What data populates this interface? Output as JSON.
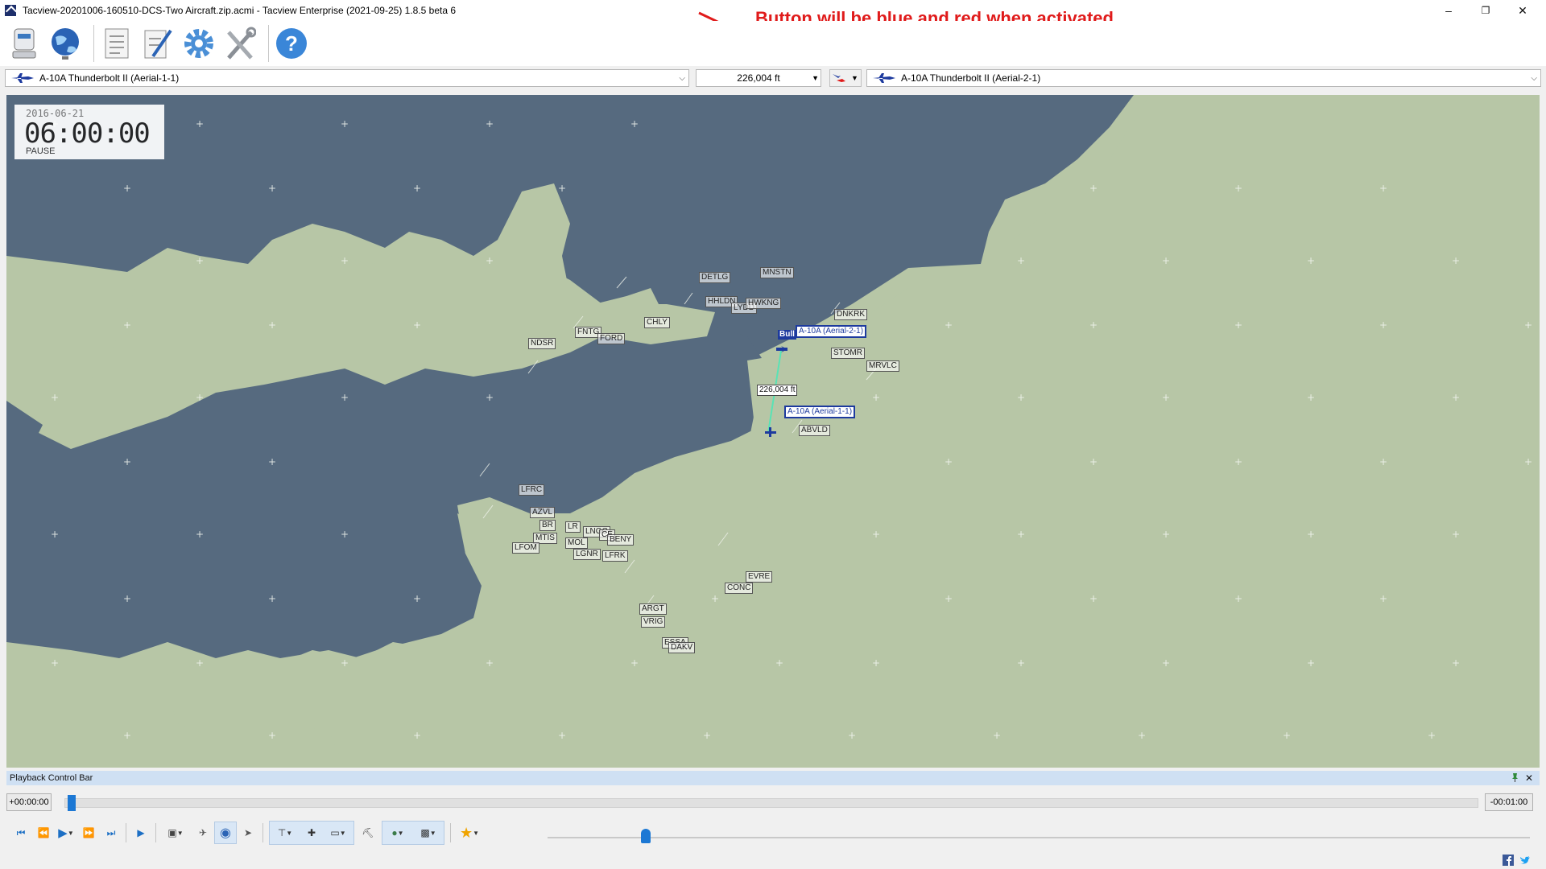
{
  "window": {
    "title": "Tacview-20201006-160510-DCS-Two Aircraft.zip.acmi - Tacview Enterprise (2021-09-25) 1.8.5 beta 6",
    "minimize": "–",
    "maximize": "❐",
    "close": "✕"
  },
  "annotation": {
    "text": "Button will be blue and red when activated",
    "color": "#e01b1b"
  },
  "toolbar": {
    "icons": [
      "recorder-icon",
      "globe-network-icon",
      "document-icon",
      "edit-notes-icon",
      "gear-icon",
      "tools-icon",
      "help-icon"
    ]
  },
  "selection": {
    "primary_object": "A-10A Thunderbolt II (Aerial-1-1)",
    "distance": "226,004 ft",
    "secondary_object": "A-10A Thunderbolt II (Aerial-2-1)",
    "link_button_colors": [
      "#1d3a9e",
      "#e01b1b"
    ]
  },
  "clock": {
    "date": "2016-06-21",
    "time": "06:00:00",
    "state": "PAUSE"
  },
  "map": {
    "sea_color": "#566a7f",
    "land_color": "#b7c6a6",
    "airfields": [
      "DETLG",
      "MNSTN",
      "HHLDN",
      "LYDD",
      "HWKNG",
      "CHLY",
      "FNTG",
      "FORD",
      "NDSR",
      "DNKRK",
      "STOMR",
      "MRVLC",
      "ABVLD",
      "LFRC",
      "AZVL",
      "BR",
      "LR",
      "LNGC",
      "CE",
      "BENY",
      "MTIS",
      "MOL",
      "LFOM",
      "LGNR",
      "LFRK",
      "EVRE",
      "CONC",
      "ARGT",
      "VRIG",
      "ESSA",
      "DAKV"
    ],
    "aircraft_1": "A-10A (Aerial-1-1)",
    "aircraft_2": "A-10A (Aerial-2-1)",
    "bullseye": "Bull",
    "distance_label": "226,004 ft"
  },
  "playback": {
    "header": "Playback Control Bar",
    "elapsed": "+00:00:00",
    "remaining": "-00:01:00",
    "progress": 0.0,
    "speed_level": 0.08
  }
}
